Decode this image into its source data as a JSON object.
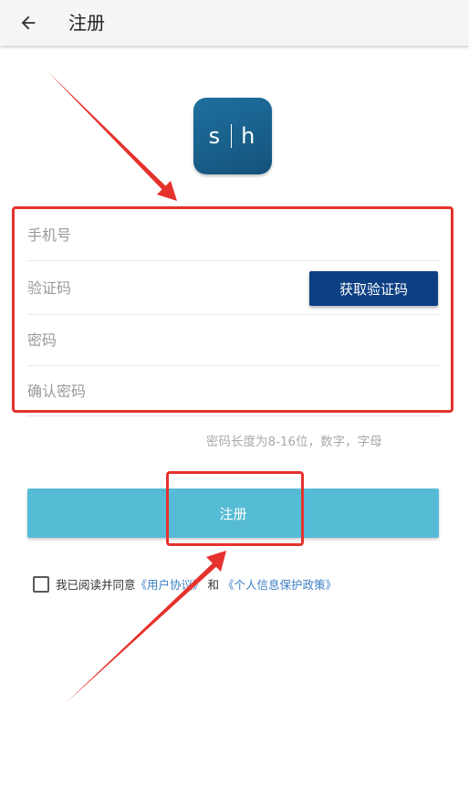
{
  "header": {
    "title": "注册",
    "back_icon": "arrow-left-icon"
  },
  "logo": {
    "left_letter": "s",
    "right_letter": "h",
    "background_color": "#1a6694"
  },
  "form": {
    "phone": {
      "placeholder": "手机号",
      "value": ""
    },
    "code": {
      "placeholder": "验证码",
      "value": "",
      "button_label": "获取验证码"
    },
    "password": {
      "placeholder": "密码",
      "value": ""
    },
    "confirm_password": {
      "placeholder": "确认密码",
      "value": ""
    },
    "hint": "密码长度为8-16位，数字，字母"
  },
  "register_button": {
    "label": "注册",
    "color": "#56bbd5"
  },
  "agreement": {
    "checked": false,
    "prefix": "我已阅读并同意",
    "user_agreement": "《用户协议》",
    "conjunction": " 和 ",
    "privacy_policy": "《个人信息保护政策》"
  },
  "colors": {
    "primary_button": "#0d3f83",
    "link": "#3b7fc4",
    "annotation": "#e5322d"
  }
}
